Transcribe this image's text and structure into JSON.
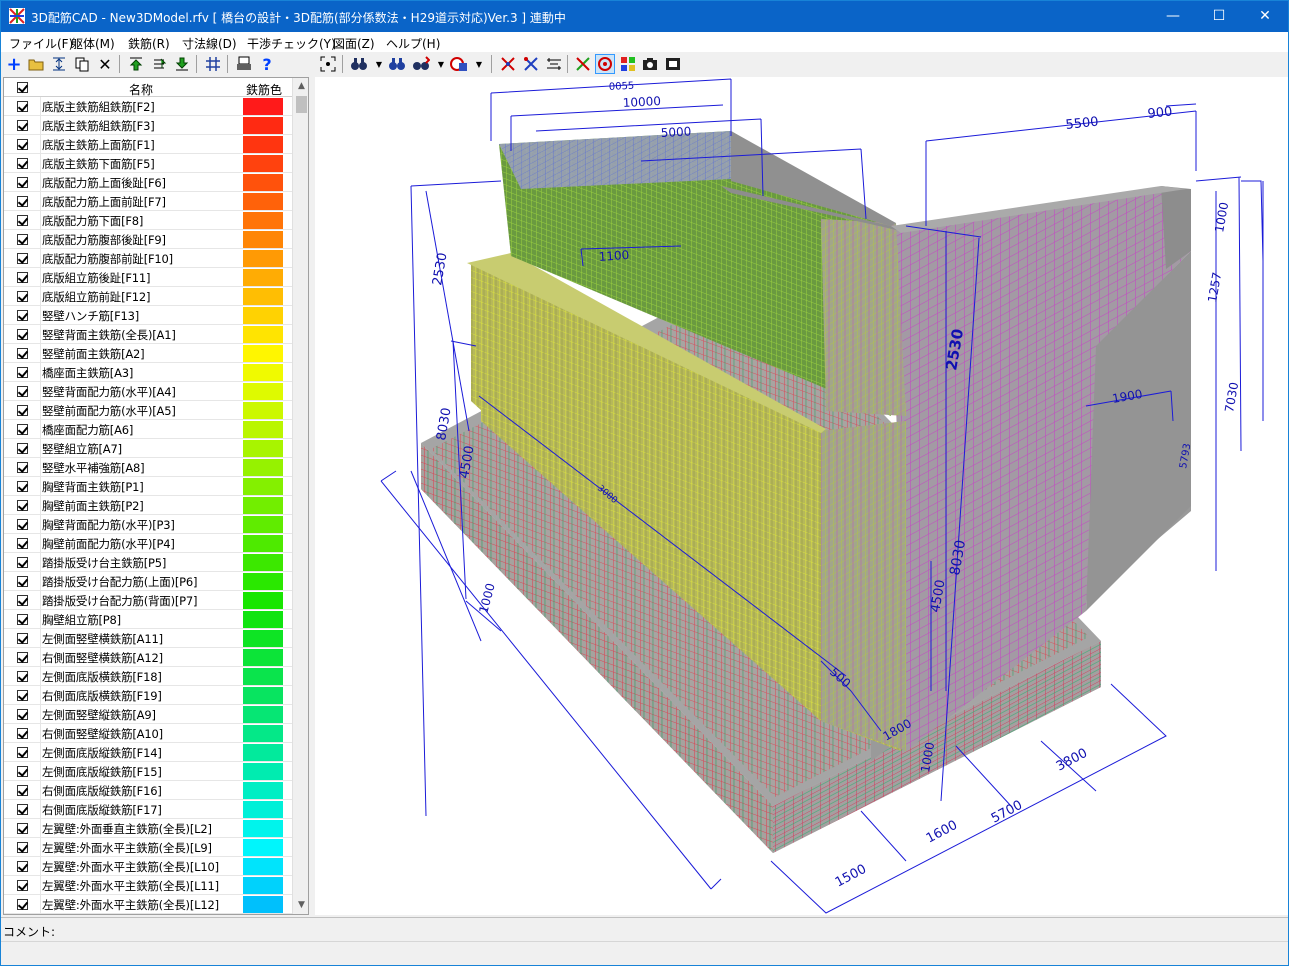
{
  "window": {
    "title": "3D配筋CAD - New3DModel.rfv [ 橋台の設計・3D配筋(部分係数法・H29道示対応)Ver.3 ] 連動中",
    "minimize": "—",
    "maximize": "☐",
    "close": "✕"
  },
  "menu": [
    "ファイル(F)",
    "躯体(M)",
    "鉄筋(R)",
    "寸法線(D)",
    "干渉チェック(Y)",
    "図面(Z)",
    "ヘルプ(H)"
  ],
  "list": {
    "header_name": "名称",
    "header_color": "鉄筋色",
    "items": [
      {
        "label": "底版主鉄筋組鉄筋[F2]",
        "color": "#ff1a1a"
      },
      {
        "label": "底版主鉄筋組鉄筋[F3]",
        "color": "#ff2a12"
      },
      {
        "label": "底版主鉄筋上面筋[F1]",
        "color": "#ff3510"
      },
      {
        "label": "底版主鉄筋下面筋[F5]",
        "color": "#ff420e"
      },
      {
        "label": "底版配力筋上面後趾[F6]",
        "color": "#ff520c"
      },
      {
        "label": "底版配力筋上面前趾[F7]",
        "color": "#ff620a"
      },
      {
        "label": "底版配力筋下面[F8]",
        "color": "#ff7408"
      },
      {
        "label": "底版配力筋腹部後趾[F9]",
        "color": "#ff8606"
      },
      {
        "label": "底版配力筋腹部前趾[F10]",
        "color": "#ff9a05"
      },
      {
        "label": "底版組立筋後趾[F11]",
        "color": "#ffac04"
      },
      {
        "label": "底版組立筋前趾[F12]",
        "color": "#ffbe03"
      },
      {
        "label": "竪壁ハンチ筋[F13]",
        "color": "#ffd202"
      },
      {
        "label": "竪壁背面主鉄筋(全長)[A1]",
        "color": "#ffe401"
      },
      {
        "label": "竪壁前面主鉄筋[A2]",
        "color": "#fff600"
      },
      {
        "label": "橋座面主鉄筋[A3]",
        "color": "#f0fa00"
      },
      {
        "label": "竪壁背面配力筋(水平)[A4]",
        "color": "#defa00"
      },
      {
        "label": "竪壁前面配力筋(水平)[A5]",
        "color": "#ccf800"
      },
      {
        "label": "橋座面配力筋[A6]",
        "color": "#baf600"
      },
      {
        "label": "竪壁組立筋[A7]",
        "color": "#a8f400"
      },
      {
        "label": "竪壁水平補強筋[A8]",
        "color": "#96f200"
      },
      {
        "label": "胸壁背面主鉄筋[P1]",
        "color": "#84f000"
      },
      {
        "label": "胸壁前面主鉄筋[P2]",
        "color": "#72ee00"
      },
      {
        "label": "胸壁背面配力筋(水平)[P3]",
        "color": "#60ec00"
      },
      {
        "label": "胸壁前面配力筋(水平)[P4]",
        "color": "#4eea00"
      },
      {
        "label": "踏掛版受け台主鉄筋[P5]",
        "color": "#3ce800"
      },
      {
        "label": "踏掛版受け台配力筋(上面)[P6]",
        "color": "#2ae800"
      },
      {
        "label": "踏掛版受け台配力筋(背面)[P7]",
        "color": "#18e600"
      },
      {
        "label": "胸壁組立筋[P8]",
        "color": "#10e410"
      },
      {
        "label": "左側面竪壁横鉄筋[A11]",
        "color": "#0ee424"
      },
      {
        "label": "右側面竪壁横鉄筋[A12]",
        "color": "#0ce438"
      },
      {
        "label": "左側面底版横鉄筋[F18]",
        "color": "#0ae44c"
      },
      {
        "label": "右側面底版横鉄筋[F19]",
        "color": "#08e460"
      },
      {
        "label": "左側面竪壁縦鉄筋[A9]",
        "color": "#06e674"
      },
      {
        "label": "右側面竪壁縦鉄筋[A10]",
        "color": "#04e888"
      },
      {
        "label": "左側面底版縦鉄筋[F14]",
        "color": "#02ea9c"
      },
      {
        "label": "左側面底版縦鉄筋[F15]",
        "color": "#00ecb0"
      },
      {
        "label": "右側面底版縦鉄筋[F16]",
        "color": "#00eec4"
      },
      {
        "label": "右側面底版縦鉄筋[F17]",
        "color": "#00f0d8"
      },
      {
        "label": "左翼壁:外面垂直主鉄筋(全長)[L2]",
        "color": "#00f4ec"
      },
      {
        "label": "左翼壁:外面水平主鉄筋(全長)[L9]",
        "color": "#00f6fc"
      },
      {
        "label": "左翼壁:外面水平主鉄筋(全長)[L10]",
        "color": "#00e4fc"
      },
      {
        "label": "左翼壁:外面水平主鉄筋(全長)[L11]",
        "color": "#00d2fc"
      },
      {
        "label": "左翼壁:外面水平主鉄筋(全長)[L12]",
        "color": "#00c0fc"
      }
    ]
  },
  "dimensions": [
    "0055",
    "10000",
    "5000",
    "5500",
    "900",
    "1100",
    "2530",
    "1000",
    "1257",
    "1900",
    "2530",
    "7030",
    "5793",
    "8030",
    "4500",
    "8030",
    "4500",
    "3000",
    "1000",
    "1800",
    "1000",
    "3800",
    "5700",
    "1600",
    "1500",
    "1000",
    "500"
  ],
  "status": {
    "comment_label": "コメント:"
  },
  "colors": {
    "title_bg": "#0a64c8",
    "dim_line": "#1b1bd8",
    "concrete": "#9a9a9a"
  }
}
